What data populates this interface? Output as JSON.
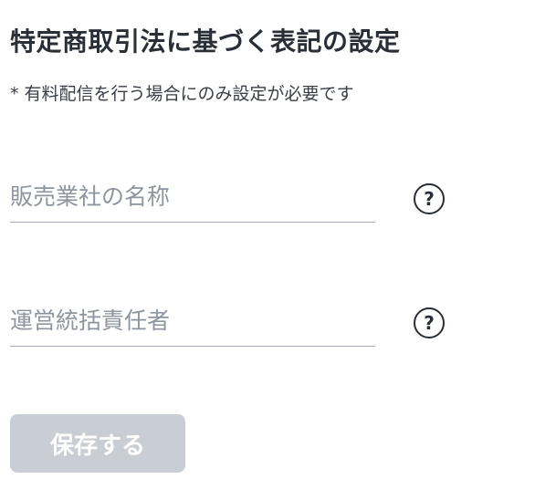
{
  "section": {
    "title": "特定商取引法に基づく表記の設定",
    "note": "* 有料配信を行う場合にのみ設定が必要です"
  },
  "fields": [
    {
      "placeholder": "販売業社の名称",
      "value": "",
      "help_icon": "question-circle-icon",
      "help_glyph": "?"
    },
    {
      "placeholder": "運営統括責任者",
      "value": "",
      "help_icon": "question-circle-icon",
      "help_glyph": "?"
    }
  ],
  "actions": {
    "save_label": "保存する",
    "save_enabled": false
  },
  "colors": {
    "text": "#2a2e36",
    "placeholder": "#8e959e",
    "underline": "#a3aab3",
    "button_disabled": "#c9ced4"
  }
}
